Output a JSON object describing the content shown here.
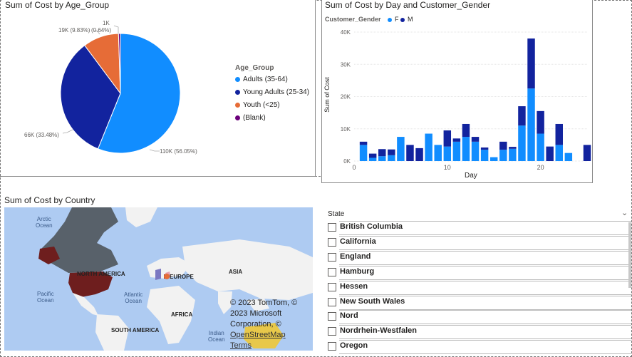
{
  "pie": {
    "title": "Sum of Cost by Age_Group",
    "legend_title": "Age_Group",
    "labels": {
      "adults": "110K (56.05%)",
      "young": "66K (33.48%)",
      "youth": "19K (9.83%)",
      "blank_pct": "(0.64%)",
      "blank_val": "1K"
    }
  },
  "bar": {
    "title": "Sum of Cost by Day and Customer_Gender",
    "legend_title": "Customer_Gender",
    "ylabel": "Sum of Cost",
    "xlabel": "Day"
  },
  "map": {
    "title": "Sum of Cost by Country",
    "labels": {
      "arctic": "Arctic\nOcean",
      "pacific": "Pacific\nOcean",
      "atlantic": "Atlantic\nOcean",
      "indian": "Indian\nOcean",
      "north_america": "NORTH AMERICA",
      "europe": "EUROPE",
      "asia": "ASIA",
      "africa": "AFRICA",
      "south_america": "SOUTH AMERICA"
    },
    "attribution": {
      "line1": "© 2023 TomTom, ©",
      "line2": "2023 Microsoft",
      "line3": "Corporation, ©",
      "line4": "OpenStreetMap",
      "line5": "Terms"
    }
  },
  "slicer": {
    "header": "State",
    "items": [
      "British Columbia",
      "California",
      "England",
      "Hamburg",
      "Hessen",
      "New South Wales",
      "Nord",
      "Nordrhein-Westfalen",
      "Oregon"
    ]
  },
  "colors": {
    "adults": "#118dff",
    "young": "#12239e",
    "youth": "#e66c37",
    "blank": "#6b007b",
    "female": "#118dff",
    "male": "#12239e"
  },
  "chart_data": [
    {
      "type": "pie",
      "title": "Sum of Cost by Age_Group",
      "legend_title": "Age_Group",
      "categories": [
        "Adults (35-64)",
        "Young Adults (25-34)",
        "Youth (<25)",
        "(Blank)"
      ],
      "values": [
        110000,
        66000,
        19000,
        1000
      ],
      "percents": [
        56.05,
        33.48,
        9.83,
        0.64
      ],
      "legend": "right"
    },
    {
      "type": "bar",
      "stacked": true,
      "title": "Sum of Cost by Day and Customer_Gender",
      "legend_title": "Customer_Gender",
      "xlabel": "Day",
      "ylabel": "Sum of Cost",
      "yticks": [
        "0K",
        "10K",
        "20K",
        "30K",
        "40K"
      ],
      "xticks": [
        0,
        10,
        20
      ],
      "ylim": [
        0,
        40000
      ],
      "xlim": [
        0,
        25
      ],
      "legend": "top-left",
      "x": [
        1,
        2,
        3,
        4,
        5,
        6,
        7,
        8,
        9,
        10,
        11,
        12,
        13,
        14,
        15,
        16,
        17,
        18,
        19,
        20,
        21,
        22,
        23,
        24,
        25
      ],
      "series": [
        {
          "name": "F",
          "values": [
            5000,
            1000,
            1500,
            1800,
            7500,
            0,
            0,
            8500,
            5000,
            4500,
            6000,
            7500,
            6000,
            3500,
            1200,
            3500,
            3800,
            11000,
            22500,
            8500,
            0,
            5000,
            2500,
            0,
            0
          ]
        },
        {
          "name": "M",
          "values": [
            1000,
            1300,
            2200,
            1800,
            0,
            5000,
            4000,
            0,
            0,
            5000,
            1000,
            4000,
            1500,
            700,
            0,
            2500,
            600,
            6000,
            15500,
            7000,
            4500,
            6500,
            0,
            0,
            5000
          ]
        }
      ]
    }
  ]
}
